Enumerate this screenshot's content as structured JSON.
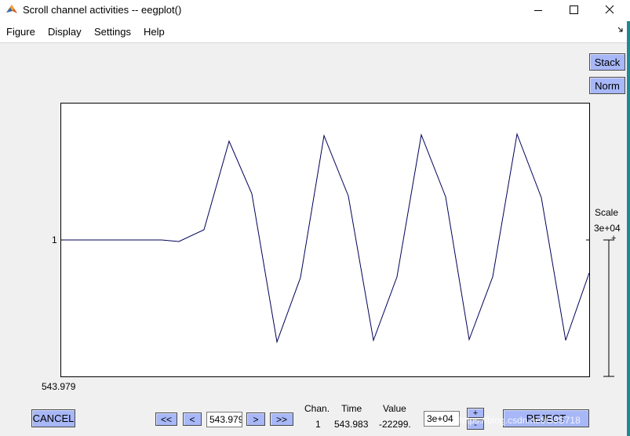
{
  "window": {
    "title": "Scroll channel activities -- eegplot()"
  },
  "menu": [
    {
      "label": "Figure"
    },
    {
      "label": "Display"
    },
    {
      "label": "Settings"
    },
    {
      "label": "Help"
    }
  ],
  "side_buttons": {
    "stack": "Stack",
    "norm": "Norm"
  },
  "plot": {
    "channel_label": "1",
    "start_time": "543.979"
  },
  "scale": {
    "title": "Scale",
    "value": "3e+04",
    "plus": "+"
  },
  "bottom": {
    "cancel": "CANCEL",
    "nav": {
      "first": "<<",
      "prev": "<",
      "next": ">",
      "last": ">>"
    },
    "time_field": "543.979",
    "readout": {
      "chan_header": "Chan.",
      "time_header": "Time",
      "value_header": "Value",
      "chan": "1",
      "time": "543.983",
      "value": "-22299."
    },
    "scale_field": "3e+04",
    "scale_plus": "+",
    "scale_minus": "-",
    "reject": "REJECT"
  },
  "watermark": "https://blog.csdn.net/G9S718",
  "colors": {
    "button": "#a7b7f7",
    "trace": "#00005a",
    "edge": "#1f8a93"
  }
}
